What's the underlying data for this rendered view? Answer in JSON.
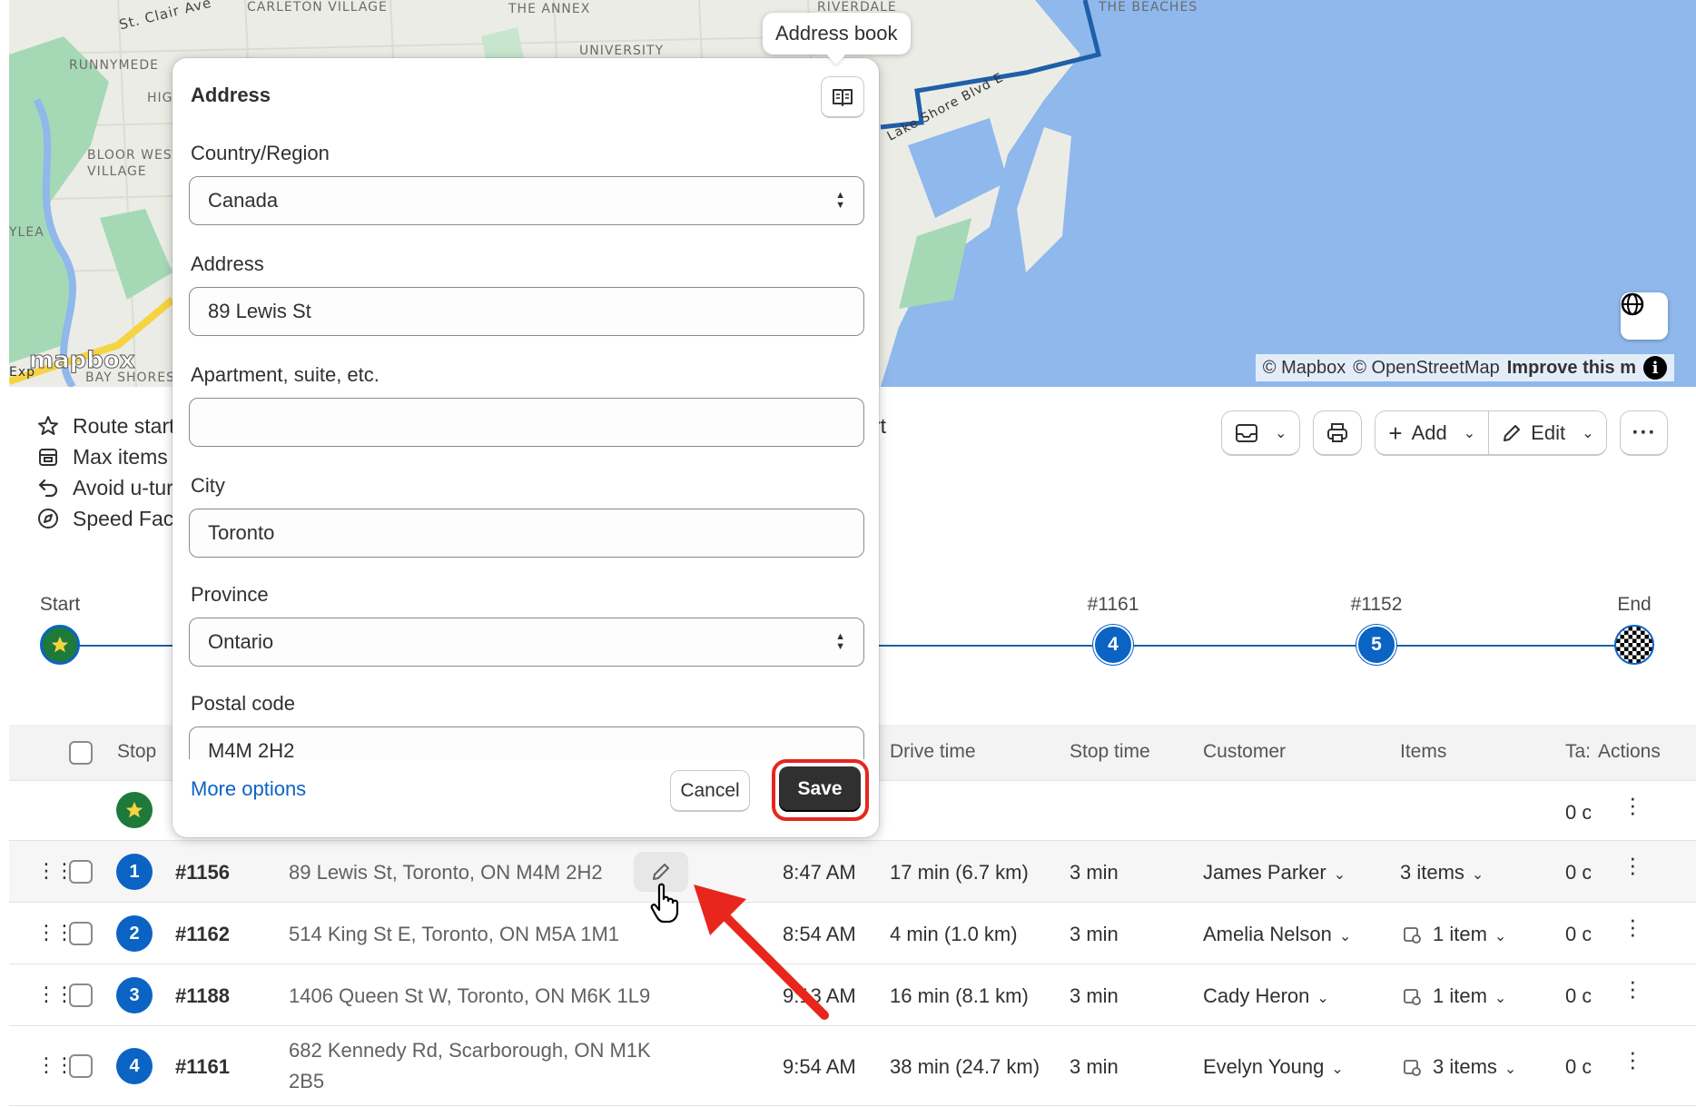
{
  "map": {
    "labels": {
      "st_clair": "St. Clair Ave",
      "carleton_village": "CARLETON VILLAGE",
      "the_annex": "THE ANNEX",
      "riverdale": "RIVERDALE",
      "the_beaches": "THE BEACHES",
      "university": "UNIVERSITY",
      "runnymede": "RUNNYMEDE",
      "high_park": "HIG N",
      "bloor_west": "BLOOR WEST VILLAGE",
      "ylea": "YLEA",
      "lake_shore": "Lake Shore Blvd E",
      "bay_shores": "BAY SHORES",
      "exp": "Exp"
    },
    "mapbox_logo": "mapbox",
    "attribution": {
      "mapbox": "© Mapbox",
      "osm": "© OpenStreetMap",
      "improve": "Improve this m"
    }
  },
  "route_info": [
    {
      "icon": "star-icon",
      "text": "Route start"
    },
    {
      "icon": "box-icon",
      "text": "Max items"
    },
    {
      "icon": "u-turn-icon",
      "text": "Avoid u-tur"
    },
    {
      "icon": "speed-icon",
      "text": "Speed Fac"
    }
  ],
  "partial_text": "rt",
  "toolbar": {
    "add_label": "Add",
    "edit_label": "Edit"
  },
  "timeline": {
    "start_label": "Start",
    "end_label": "End",
    "stops": [
      {
        "order": "#1161",
        "number": "4"
      },
      {
        "order": "#1152",
        "number": "5"
      }
    ]
  },
  "table": {
    "headers": {
      "stop": "Stop",
      "drive_time": "Drive time",
      "stop_time": "Stop time",
      "customer": "Customer",
      "items": "Items",
      "tasks": "Ta:",
      "actions": "Actions"
    },
    "start_row": {
      "tasks": "0 c"
    },
    "rows": [
      {
        "stop": "1",
        "order": "#1156",
        "address": "89 Lewis St, Toronto, ON M4M 2H2",
        "eta": "8:47 AM",
        "drive": "17 min (6.7 km)",
        "stop_time": "3 min",
        "customer": "James Parker",
        "items": "3 items",
        "tasks": "0 c"
      },
      {
        "stop": "2",
        "order": "#1162",
        "address": "514 King St E, Toronto, ON M5A 1M1",
        "eta": "8:54 AM",
        "drive": "4 min (1.0 km)",
        "stop_time": "3 min",
        "customer": "Amelia Nelson",
        "items": "1 item",
        "tasks": "0 c"
      },
      {
        "stop": "3",
        "order": "#1188",
        "address": "1406 Queen St W, Toronto, ON M6K 1L9",
        "eta": "9:13 AM",
        "drive": "16 min (8.1 km)",
        "stop_time": "3 min",
        "customer": "Cady Heron",
        "items": "1 item",
        "tasks": "0 c"
      },
      {
        "stop": "4",
        "order": "#1161",
        "address_line1": "682 Kennedy Rd, Scarborough, ON M1K",
        "address_line2": "2B5",
        "eta": "9:54 AM",
        "drive": "38 min (24.7 km)",
        "stop_time": "3 min",
        "customer": "Evelyn Young",
        "items": "3 items",
        "tasks": "0 c"
      }
    ]
  },
  "modal": {
    "tooltip": "Address book",
    "title": "Address",
    "country_label": "Country/Region",
    "country_value": "Canada",
    "address_label": "Address",
    "address_value": "89 Lewis St",
    "apt_label": "Apartment, suite, etc.",
    "apt_value": "",
    "city_label": "City",
    "city_value": "Toronto",
    "province_label": "Province",
    "province_value": "Ontario",
    "postal_label": "Postal code",
    "postal_value": "M4M 2H2",
    "more_options": "More options",
    "cancel": "Cancel",
    "save": "Save"
  },
  "colors": {
    "accent_blue": "#0b63c4",
    "annotation_red": "#e8261d",
    "water": "#8fb8ec",
    "park": "#a5d9b5"
  }
}
